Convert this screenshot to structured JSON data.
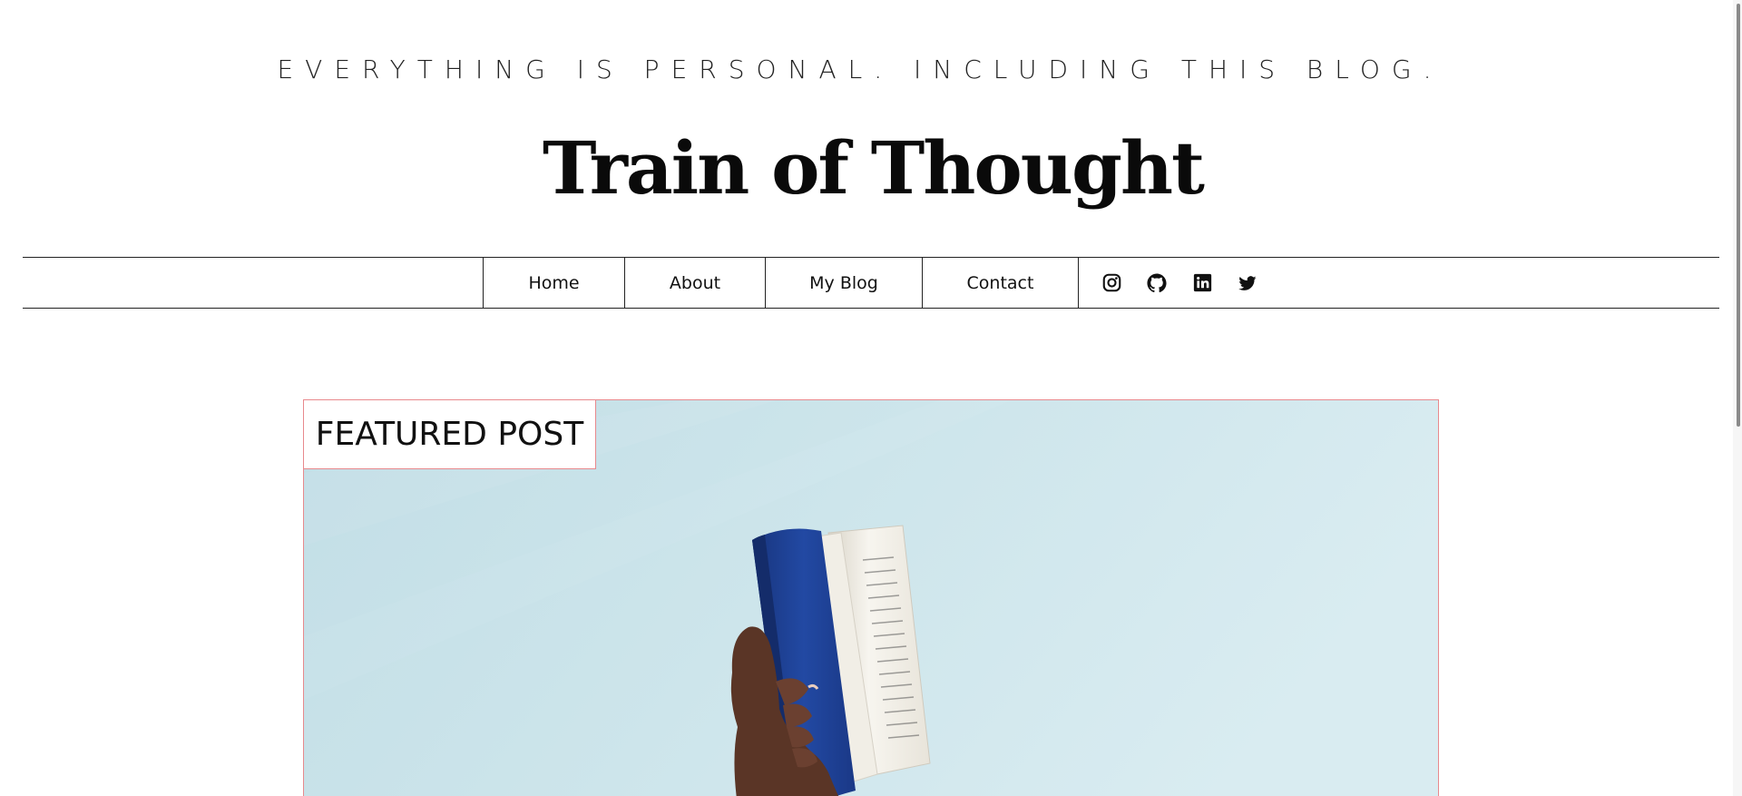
{
  "header": {
    "tagline": "EVERYTHING IS PERSONAL. INCLUDING THIS BLOG.",
    "title": "Train of Thought"
  },
  "nav": {
    "items": [
      {
        "label": "Home"
      },
      {
        "label": "About"
      },
      {
        "label": "My Blog"
      },
      {
        "label": "Contact"
      }
    ],
    "social_icons": [
      "instagram-icon",
      "github-icon",
      "linkedin-icon",
      "twitter-icon"
    ]
  },
  "featured": {
    "label": "FEATURED POST"
  },
  "colors": {
    "featured_border": "#e8898d",
    "featured_bg": "#cfe6ec",
    "book_cover": "#1f3f8f"
  }
}
